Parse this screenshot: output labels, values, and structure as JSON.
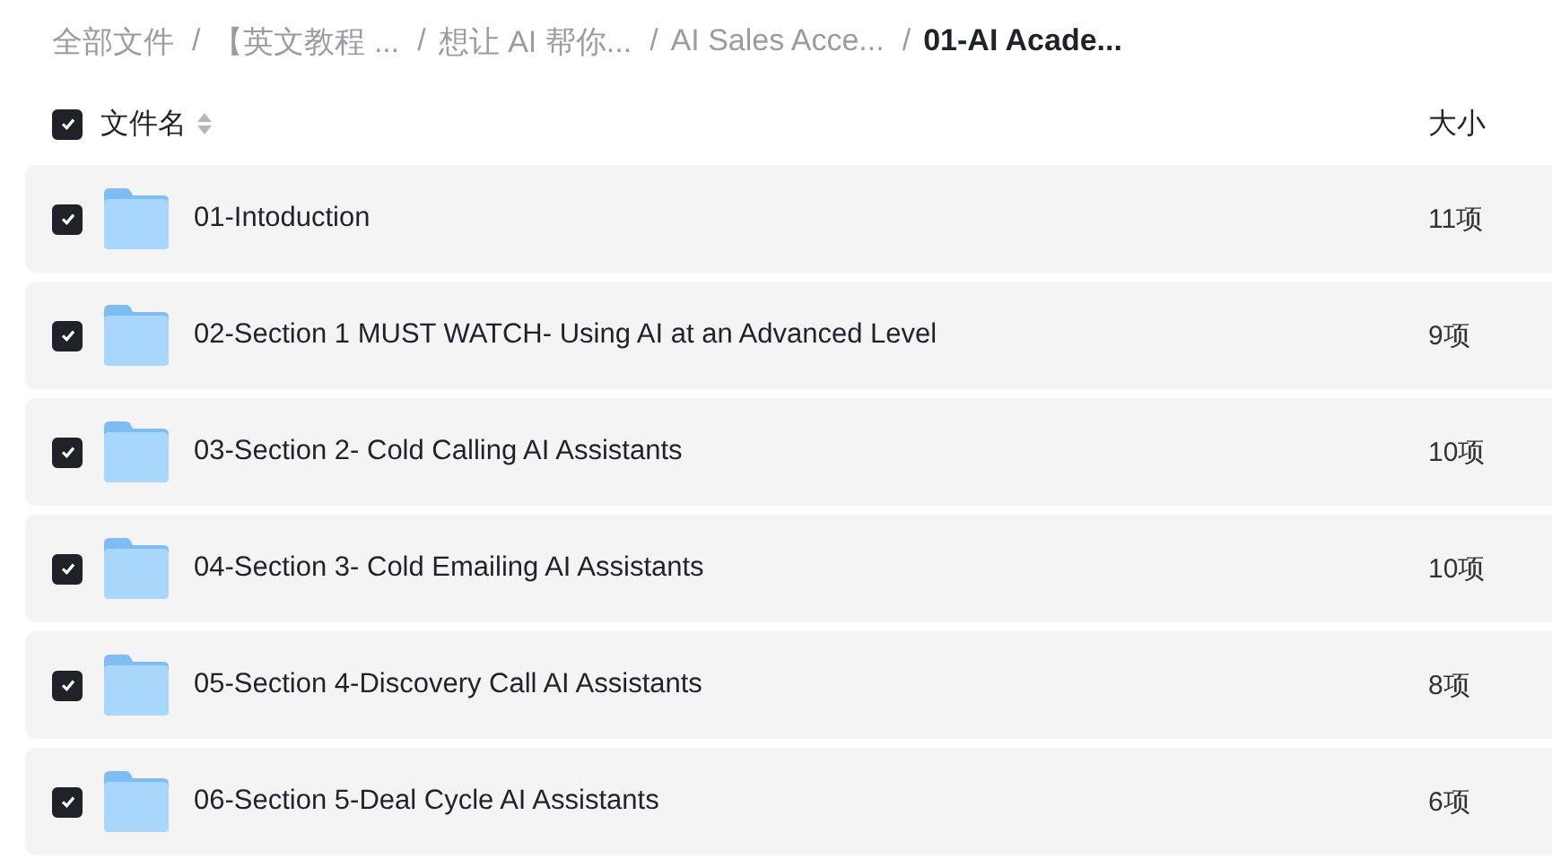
{
  "breadcrumb": [
    {
      "label": "全部文件",
      "current": false
    },
    {
      "separator": "/",
      "label": "【英文教程 ...",
      "current": false
    },
    {
      "separator": "/",
      "label": "想让 AI 帮你...",
      "current": false
    },
    {
      "separator": "/",
      "label": "AI Sales Acce...",
      "current": false
    },
    {
      "separator": "/",
      "label": "01-AI Acade...",
      "current": true
    }
  ],
  "header": {
    "checked": true,
    "name_column": "文件名",
    "size_column": "大小"
  },
  "files": [
    {
      "checked": true,
      "name": "01-Intoduction",
      "size": "11项"
    },
    {
      "checked": true,
      "name": "02-Section 1 MUST WATCH- Using AI at an Advanced Level",
      "size": "9项"
    },
    {
      "checked": true,
      "name": "03-Section 2- Cold Calling AI Assistants",
      "size": "10项"
    },
    {
      "checked": true,
      "name": "04-Section 3- Cold Emailing AI Assistants",
      "size": "10项"
    },
    {
      "checked": true,
      "name": "05-Section 4-Discovery Call AI Assistants",
      "size": "8项"
    },
    {
      "checked": true,
      "name": "06-Section 5-Deal Cycle AI Assistants",
      "size": "6项"
    }
  ]
}
